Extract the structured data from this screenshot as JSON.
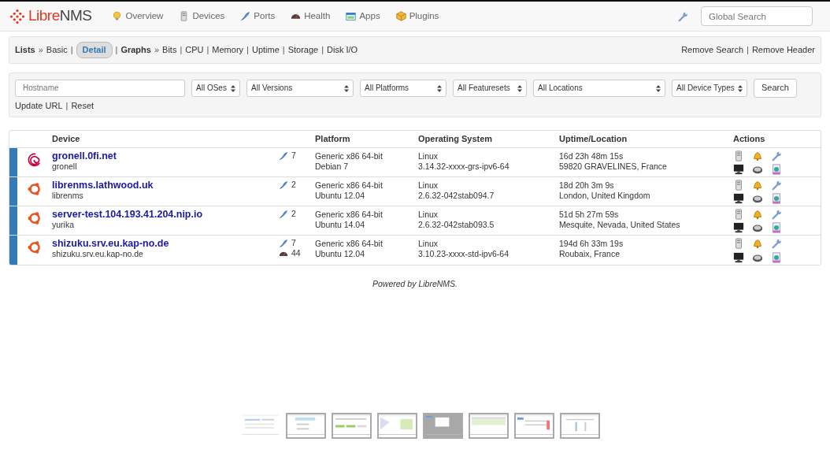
{
  "brand": {
    "part1": "Libre",
    "part2": "NMS"
  },
  "nav": [
    {
      "label": "Overview"
    },
    {
      "label": "Devices"
    },
    {
      "label": "Ports"
    },
    {
      "label": "Health"
    },
    {
      "label": "Apps"
    },
    {
      "label": "Plugins"
    }
  ],
  "global_search": {
    "placeholder": "Global Search"
  },
  "lists_bar": {
    "divider": "|",
    "groups": [
      {
        "title": "Lists",
        "separator": "»",
        "links": [
          {
            "label": "Basic",
            "selected": false
          },
          {
            "label": "Detail",
            "selected": true
          }
        ]
      },
      {
        "title": "Graphs",
        "separator": "»",
        "links": [
          {
            "label": "Bits",
            "selected": false
          },
          {
            "label": "CPU",
            "selected": false
          },
          {
            "label": "Memory",
            "selected": false
          },
          {
            "label": "Uptime",
            "selected": false
          },
          {
            "label": "Storage",
            "selected": false
          },
          {
            "label": "Disk I/O",
            "selected": false
          }
        ]
      }
    ],
    "right_links": [
      "Remove Search",
      "Remove Header"
    ]
  },
  "filters": {
    "hostname": {
      "placeholder": "Hostname"
    },
    "selects": [
      "All OSes",
      "All Versions",
      "All Platforms",
      "All Featuresets",
      "All Locations",
      "All Device Types"
    ],
    "button": "Search",
    "links": [
      "Update URL",
      "Reset"
    ],
    "divider": "|"
  },
  "table": {
    "columns": [
      "Device",
      "Platform",
      "Operating System",
      "Uptime/Location",
      "Actions"
    ],
    "rows": [
      {
        "kind": "debian",
        "hostname": "gronell.0fi.net",
        "sysname": "gronell",
        "counts": [
          {
            "kind": "ports",
            "value": "7"
          }
        ],
        "platform": "Generic x86 64-bit",
        "platform_os": "Debian 7",
        "os": "Linux",
        "version": "3.14.32-xxxx-grs-ipv6-64",
        "uptime": "16d 23h 48m 15s",
        "location": "59820 GRAVELINES, France"
      },
      {
        "kind": "ubuntu",
        "hostname": "librenms.lathwood.uk",
        "sysname": "librenms",
        "counts": [
          {
            "kind": "ports",
            "value": "2"
          }
        ],
        "platform": "Generic x86 64-bit",
        "platform_os": "Ubuntu 12.04",
        "os": "Linux",
        "version": "2.6.32-042stab094.7",
        "uptime": "18d 20h 3m 9s",
        "location": "London, United Kingdom"
      },
      {
        "kind": "ubuntu",
        "hostname": "server-test.104.193.41.204.nip.io",
        "sysname": "yurika",
        "counts": [
          {
            "kind": "ports",
            "value": "2"
          }
        ],
        "platform": "Generic x86 64-bit",
        "platform_os": "Ubuntu 14.04",
        "os": "Linux",
        "version": "2.6.32-042stab093.5",
        "uptime": "51d 5h 27m 59s",
        "location": "Mesquite, Nevada, United States"
      },
      {
        "kind": "ubuntu",
        "hostname": "shizuku.srv.eu.kap-no.de",
        "sysname": "shizuku.srv.eu.kap-no.de",
        "counts": [
          {
            "kind": "ports",
            "value": "7"
          },
          {
            "kind": "health",
            "value": "44"
          }
        ],
        "platform": "Generic x86 64-bit",
        "platform_os": "Ubuntu 12.04",
        "os": "Linux",
        "version": "3.10.23-xxxx-std-ipv6-64",
        "uptime": "194d 6h 33m 19s",
        "location": "Roubaix, France"
      }
    ]
  },
  "footer": {
    "text": "Powered by",
    "link": "LibreNMS",
    "end": "."
  },
  "thumbnails": [
    {
      "selected": true
    },
    {
      "selected": false
    },
    {
      "selected": false
    },
    {
      "selected": false
    },
    {
      "selected": false
    },
    {
      "selected": false
    },
    {
      "selected": false
    },
    {
      "selected": false
    }
  ]
}
